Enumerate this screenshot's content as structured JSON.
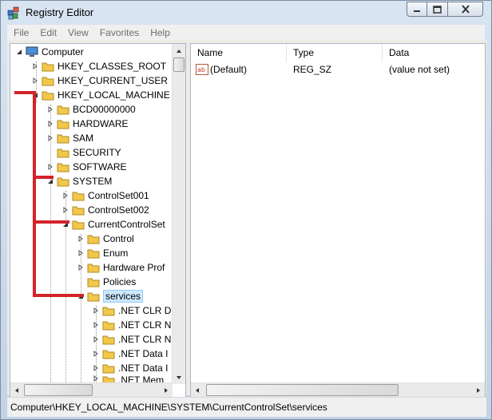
{
  "window": {
    "title": "Registry Editor"
  },
  "menu": [
    "File",
    "Edit",
    "View",
    "Favorites",
    "Help"
  ],
  "tree": {
    "root": "Computer",
    "items": [
      {
        "label": "HKEY_CLASSES_ROOT"
      },
      {
        "label": "HKEY_CURRENT_USER"
      },
      {
        "label": "HKEY_LOCAL_MACHINE"
      },
      {
        "label": "BCD00000000"
      },
      {
        "label": "HARDWARE"
      },
      {
        "label": "SAM"
      },
      {
        "label": "SECURITY"
      },
      {
        "label": "SOFTWARE"
      },
      {
        "label": "SYSTEM"
      },
      {
        "label": "ControlSet001"
      },
      {
        "label": "ControlSet002"
      },
      {
        "label": "CurrentControlSet"
      },
      {
        "label": "Control"
      },
      {
        "label": "Enum"
      },
      {
        "label": "Hardware Prof"
      },
      {
        "label": "Policies"
      },
      {
        "label": "services"
      },
      {
        "label": ".NET CLR D"
      },
      {
        "label": ".NET CLR N"
      },
      {
        "label": ".NET CLR N"
      },
      {
        "label": ".NET Data I"
      },
      {
        "label": ".NET Data I"
      },
      {
        "label": ".NET Mem"
      }
    ]
  },
  "list": {
    "columns": [
      "Name",
      "Type",
      "Data"
    ],
    "rows": [
      {
        "name": "(Default)",
        "type": "REG_SZ",
        "data": "(value not set)",
        "icon": "ab"
      }
    ]
  },
  "status": {
    "path": "Computer\\HKEY_LOCAL_MACHINE\\SYSTEM\\CurrentControlSet\\services"
  },
  "colors": {
    "annotation": "#d2232a",
    "selection": "#cde8ff",
    "folder": "#f2c84b"
  }
}
